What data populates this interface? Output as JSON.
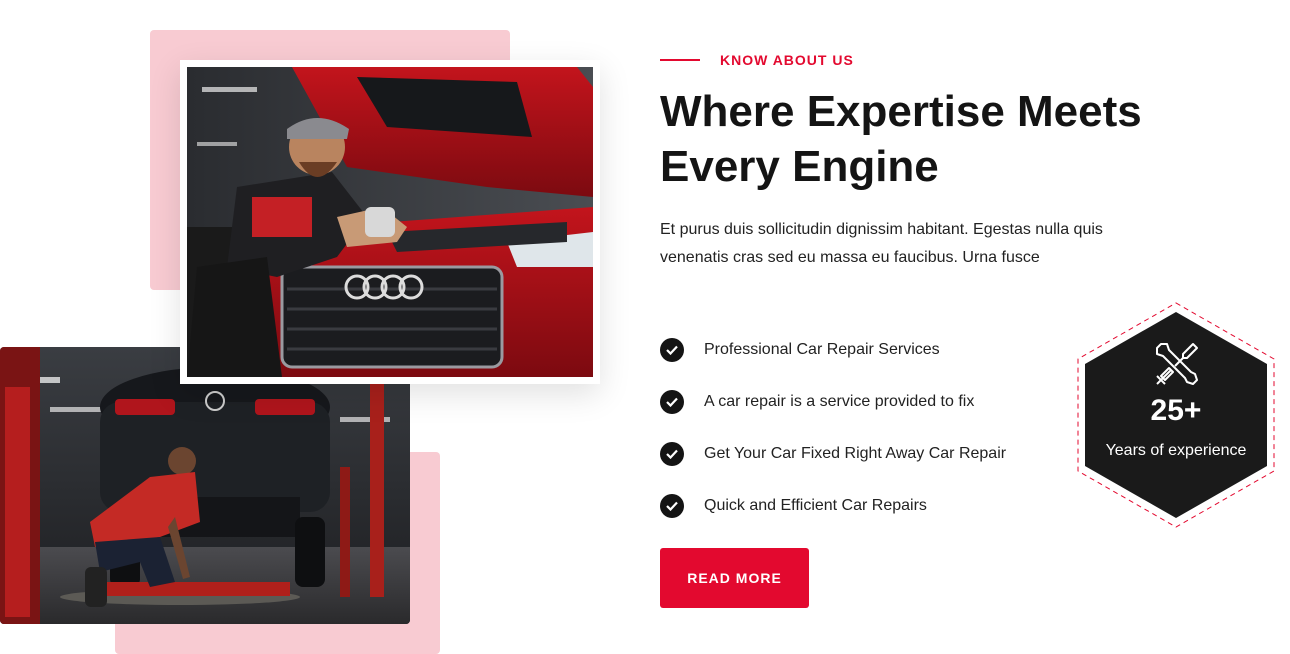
{
  "about": {
    "kicker": "KNOW ABOUT US",
    "title": "Where Expertise Meets Every Engine",
    "description": "Et purus duis sollicitudin dignissim habitant. Egestas nulla quis venenatis cras sed eu massa eu faucibus. Urna fusce",
    "features": [
      "Professional Car Repair Services",
      "A car repair is a service provided to fix",
      "Get Your Car Fixed Right Away Car Repair",
      "Quick and Efficient Car Repairs"
    ],
    "button_label": "READ MORE"
  },
  "badge": {
    "number": "25+",
    "label": "Years of experience",
    "icon": "wrench-cross-icon"
  },
  "images": {
    "main": "mechanic-under-hood-photo",
    "secondary": "mechanic-under-lifted-car-photo"
  },
  "colors": {
    "accent": "#e3092f",
    "pink": "#f8cbd2",
    "dark": "#141414"
  }
}
